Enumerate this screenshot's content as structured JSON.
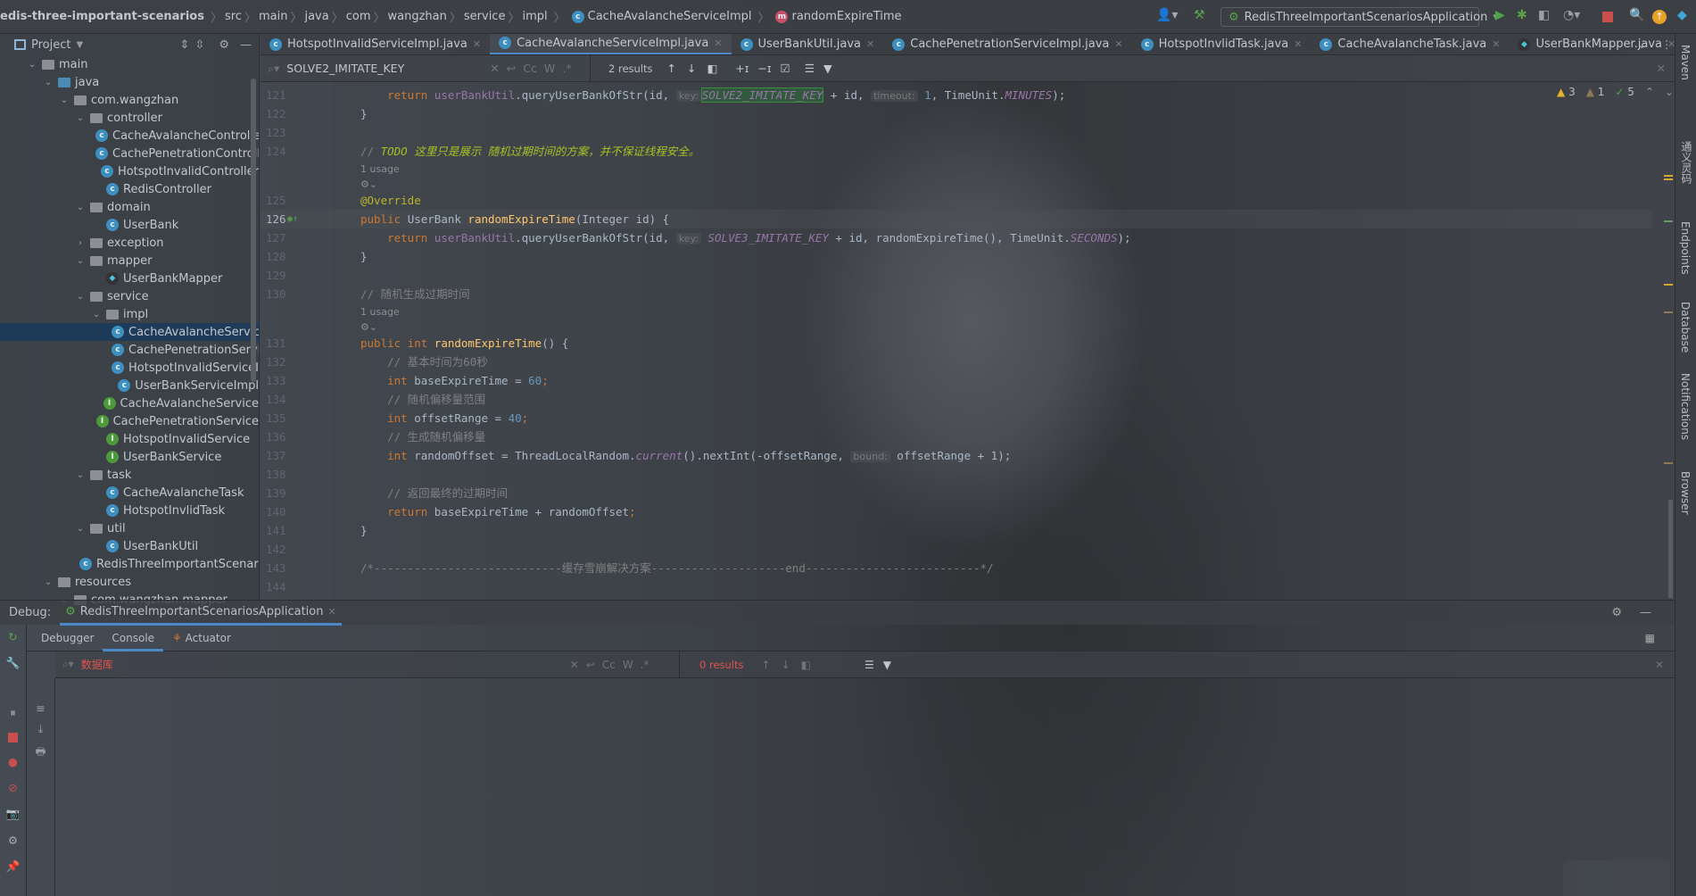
{
  "breadcrumb": {
    "project": "edis-three-important-scenarios",
    "parts": [
      "src",
      "main",
      "java",
      "com",
      "wangzhan",
      "service",
      "impl"
    ],
    "class": "CacheAvalancheServiceImpl",
    "method": "randomExpireTime"
  },
  "toolbar": {
    "run_config": "RedisThreeImportantScenariosApplication"
  },
  "project_panel": {
    "title": "Project",
    "tree": [
      {
        "label": "main",
        "depth": 2,
        "type": "folder",
        "open": true
      },
      {
        "label": "java",
        "depth": 3,
        "type": "folder-blue",
        "open": true
      },
      {
        "label": "com.wangzhan",
        "depth": 4,
        "type": "package",
        "open": true
      },
      {
        "label": "controller",
        "depth": 5,
        "type": "package",
        "open": true
      },
      {
        "label": "CacheAvalancheController",
        "depth": 6,
        "type": "class"
      },
      {
        "label": "CachePenetrationController",
        "depth": 6,
        "type": "class"
      },
      {
        "label": "HotspotInvalidController",
        "depth": 6,
        "type": "class"
      },
      {
        "label": "RedisController",
        "depth": 6,
        "type": "class"
      },
      {
        "label": "domain",
        "depth": 5,
        "type": "package",
        "open": true
      },
      {
        "label": "UserBank",
        "depth": 6,
        "type": "class"
      },
      {
        "label": "exception",
        "depth": 5,
        "type": "package",
        "open": false
      },
      {
        "label": "mapper",
        "depth": 5,
        "type": "package",
        "open": true
      },
      {
        "label": "UserBankMapper",
        "depth": 6,
        "type": "mapper"
      },
      {
        "label": "service",
        "depth": 5,
        "type": "package",
        "open": true
      },
      {
        "label": "impl",
        "depth": 6,
        "type": "package",
        "open": true
      },
      {
        "label": "CacheAvalancheServiceImpl",
        "depth": 7,
        "type": "class",
        "selected": true
      },
      {
        "label": "CachePenetrationServiceImpl",
        "depth": 7,
        "type": "class"
      },
      {
        "label": "HotspotInvalidServiceImpl",
        "depth": 7,
        "type": "class"
      },
      {
        "label": "UserBankServiceImpl",
        "depth": 7,
        "type": "class"
      },
      {
        "label": "CacheAvalancheService",
        "depth": 6,
        "type": "interface"
      },
      {
        "label": "CachePenetrationService",
        "depth": 6,
        "type": "interface"
      },
      {
        "label": "HotspotInvalidService",
        "depth": 6,
        "type": "interface"
      },
      {
        "label": "UserBankService",
        "depth": 6,
        "type": "interface"
      },
      {
        "label": "task",
        "depth": 5,
        "type": "package",
        "open": true
      },
      {
        "label": "CacheAvalancheTask",
        "depth": 6,
        "type": "class"
      },
      {
        "label": "HotspotInvlidTask",
        "depth": 6,
        "type": "class"
      },
      {
        "label": "util",
        "depth": 5,
        "type": "package",
        "open": true
      },
      {
        "label": "UserBankUtil",
        "depth": 6,
        "type": "class"
      },
      {
        "label": "RedisThreeImportantScenariosApplication",
        "depth": 5,
        "type": "app"
      },
      {
        "label": "resources",
        "depth": 3,
        "type": "folder",
        "open": true
      },
      {
        "label": "com.wangzhan.mapper",
        "depth": 4,
        "type": "folder",
        "open": true
      }
    ]
  },
  "tabs": [
    {
      "label": "HotspotInvalidServiceImpl.java",
      "icon": "class"
    },
    {
      "label": "CacheAvalancheServiceImpl.java",
      "icon": "class",
      "active": true
    },
    {
      "label": "UserBankUtil.java",
      "icon": "class"
    },
    {
      "label": "CachePenetrationServiceImpl.java",
      "icon": "class"
    },
    {
      "label": "HotspotInvlidTask.java",
      "icon": "class"
    },
    {
      "label": "CacheAvalancheTask.java",
      "icon": "class"
    },
    {
      "label": "UserBankMapper.java",
      "icon": "mapper"
    },
    {
      "label": "UserBankMapp",
      "icon": "mapper"
    }
  ],
  "find": {
    "query": "SOLVE2_IMITATE_KEY",
    "results": "2 results",
    "cc": "Cc",
    "w": "W",
    "regex": ".*"
  },
  "inspections": {
    "warnings": "3",
    "weak_warnings": "1",
    "ok": "5"
  },
  "code": [
    {
      "n": "121",
      "t": [
        [
          "kw",
          "    return "
        ],
        [
          "field",
          "userBankUtil"
        ],
        [
          "plain",
          ".queryUserBankOfStr(id, "
        ],
        [
          "hint",
          "key:"
        ],
        [
          "str hl",
          "SOLVE2_IMITATE_KEY"
        ],
        [
          "plain",
          " + id, "
        ],
        [
          "hint",
          "timeout:"
        ],
        [
          "num",
          " 1"
        ],
        [
          "plain",
          ", TimeUnit."
        ],
        [
          "str",
          "MINUTES"
        ],
        [
          "plain",
          ");"
        ]
      ]
    },
    {
      "n": "122",
      "t": [
        [
          "plain",
          "}"
        ]
      ]
    },
    {
      "n": "123",
      "t": []
    },
    {
      "n": "124",
      "t": [
        [
          "cm",
          "// "
        ],
        [
          "todo",
          "TODO 这里只是展示 随机过期时间的方案，并不保证线程安全。"
        ]
      ]
    },
    {
      "usage": "1 usage"
    },
    {
      "icon": true
    },
    {
      "n": "125",
      "t": [
        [
          "ann",
          "@Override"
        ]
      ]
    },
    {
      "n": "126",
      "t": [
        [
          "kw",
          "public "
        ],
        [
          "plain",
          "UserBank "
        ],
        [
          "fn",
          "randomExpireTime"
        ],
        [
          "plain",
          "(Integer id) {"
        ]
      ]
    },
    {
      "n": "127",
      "t": [
        [
          "kw",
          "    return "
        ],
        [
          "field",
          "userBankUtil"
        ],
        [
          "plain",
          ".queryUserBankOfStr(id, "
        ],
        [
          "hint",
          "key:"
        ],
        [
          "str",
          " SOLVE3_IMITATE_KEY"
        ],
        [
          "plain",
          " + id, randomExpireTime(), TimeUnit."
        ],
        [
          "str",
          "SECONDS"
        ],
        [
          "plain",
          ");"
        ]
      ]
    },
    {
      "n": "128",
      "t": [
        [
          "plain",
          "}"
        ]
      ]
    },
    {
      "n": "129",
      "t": []
    },
    {
      "n": "130",
      "t": [
        [
          "cm",
          "// 随机生成过期时间"
        ]
      ]
    },
    {
      "usage": "1 usage"
    },
    {
      "icon": true
    },
    {
      "n": "131",
      "t": [
        [
          "kw",
          "public int "
        ],
        [
          "fn",
          "randomExpireTime"
        ],
        [
          "plain",
          "() {"
        ]
      ]
    },
    {
      "n": "132",
      "t": [
        [
          "cm",
          "    // 基本时间为60秒"
        ]
      ]
    },
    {
      "n": "133",
      "t": [
        [
          "kw",
          "    int "
        ],
        [
          "plain",
          "baseExpireTime = "
        ],
        [
          "num",
          "60"
        ],
        [
          "kw",
          ";"
        ]
      ]
    },
    {
      "n": "134",
      "t": [
        [
          "cm",
          "    // 随机偏移量范围"
        ]
      ]
    },
    {
      "n": "135",
      "t": [
        [
          "kw",
          "    int "
        ],
        [
          "plain",
          "offsetRange = "
        ],
        [
          "num",
          "40"
        ],
        [
          "kw",
          ";"
        ]
      ]
    },
    {
      "n": "136",
      "t": [
        [
          "cm",
          "    // 生成随机偏移量"
        ]
      ]
    },
    {
      "n": "137",
      "t": [
        [
          "kw",
          "    int "
        ],
        [
          "plain",
          "randomOffset = ThreadLocalRandom."
        ],
        [
          "str",
          "current"
        ],
        [
          "plain",
          "().nextInt(-offsetRange, "
        ],
        [
          "hint",
          "bound:"
        ],
        [
          "plain",
          " offsetRange + 1);"
        ]
      ]
    },
    {
      "n": "138",
      "t": []
    },
    {
      "n": "139",
      "t": [
        [
          "cm",
          "    // 返回最终的过期时间"
        ]
      ]
    },
    {
      "n": "140",
      "t": [
        [
          "kw",
          "    return "
        ],
        [
          "plain",
          "baseExpireTime + randomOffset"
        ],
        [
          "kw",
          ";"
        ]
      ]
    },
    {
      "n": "141",
      "t": [
        [
          "plain",
          "}"
        ]
      ]
    },
    {
      "n": "142",
      "t": []
    },
    {
      "n": "143",
      "t": [
        [
          "cm",
          "/*----------------------------缓存雪崩解决方案--------------------end--------------------------*/"
        ]
      ]
    },
    {
      "n": "144",
      "t": []
    }
  ],
  "debug": {
    "label": "Debug:",
    "session": "RedisThreeImportantScenariosApplication",
    "tabs": [
      "Debugger",
      "Console",
      "Actuator"
    ],
    "active_tab": "Console",
    "search_query": "数据库",
    "results": "0 results"
  },
  "right_strip": [
    "Maven",
    "通义灵码",
    "Endpoints",
    "Database",
    "Notifications",
    "Browser"
  ],
  "colors": {
    "accent": "#4a88c7",
    "selection": "#1f3b5a",
    "error_text": "#e0534f"
  }
}
